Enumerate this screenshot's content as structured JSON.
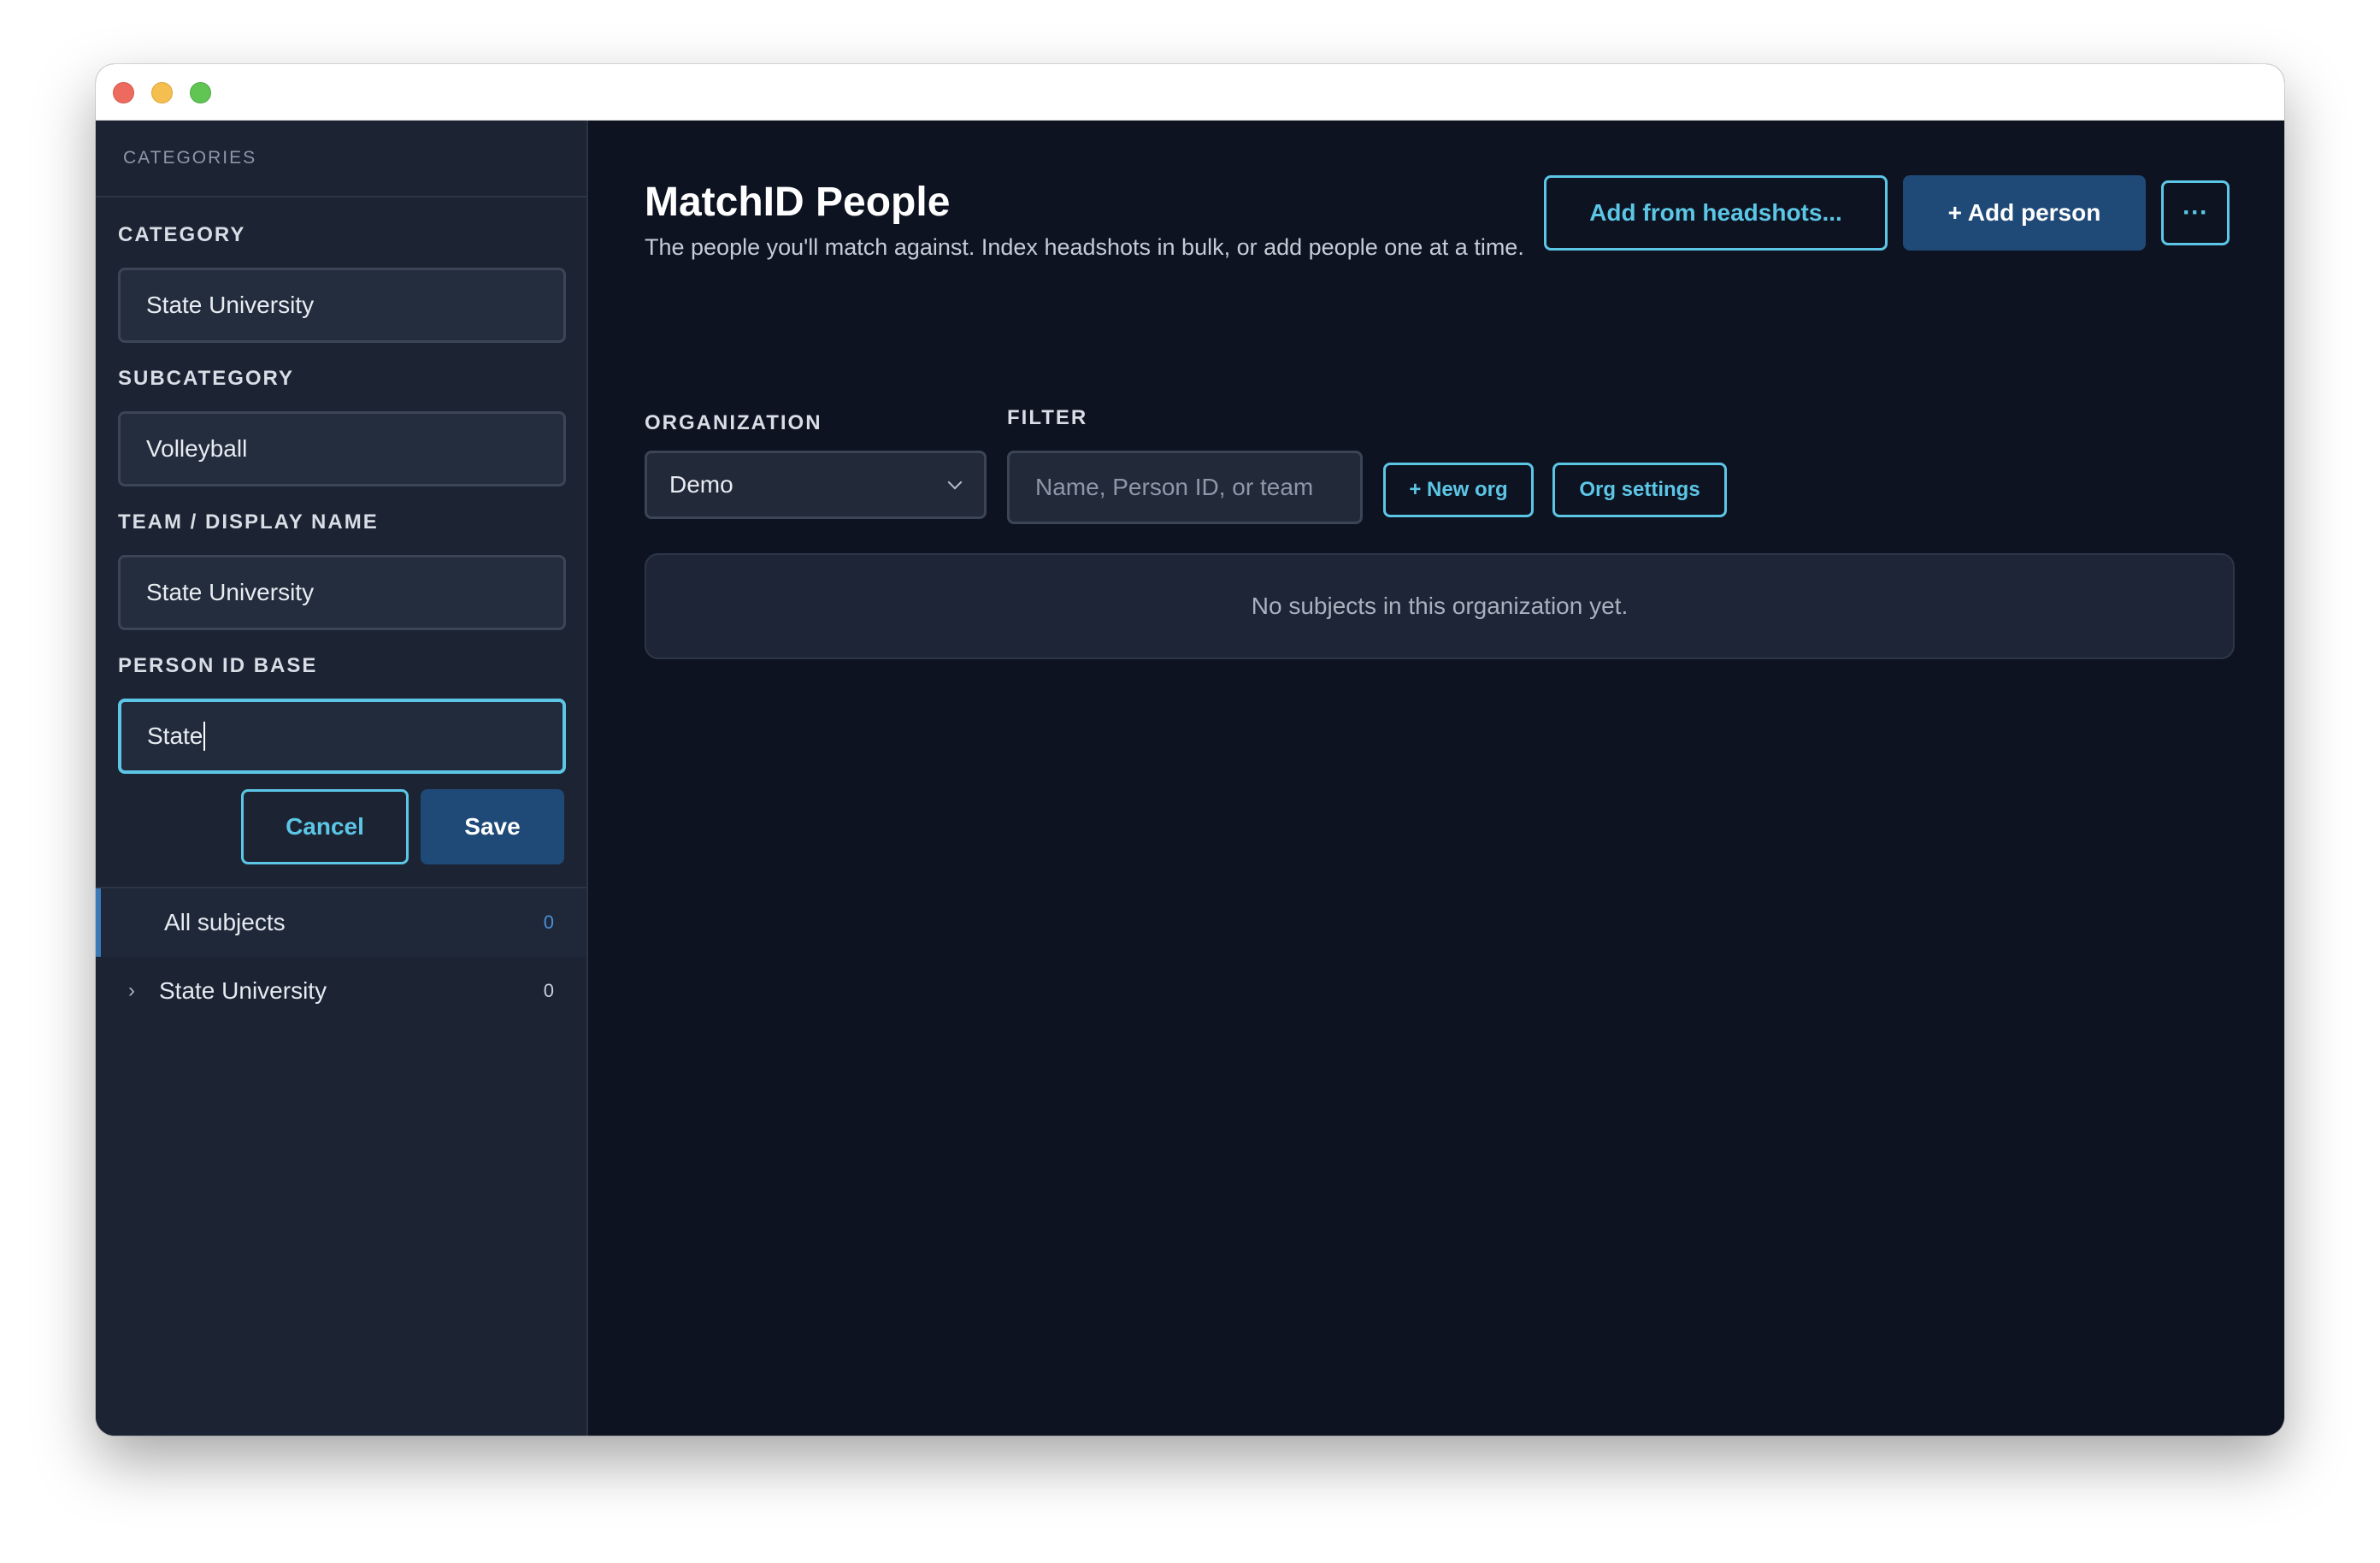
{
  "sidebar": {
    "header": "CATEGORIES",
    "form": {
      "category_label": "CATEGORY",
      "category_value": "State University",
      "subcategory_label": "SUBCATEGORY",
      "subcategory_value": "Volleyball",
      "team_label": "TEAM / DISPLAY NAME",
      "team_value": "State University",
      "person_id_label": "PERSON ID BASE",
      "person_id_value": "State",
      "cancel_label": "Cancel",
      "save_label": "Save"
    },
    "tree": [
      {
        "label": "All subjects",
        "count": "0",
        "active": true
      },
      {
        "label": "State University",
        "count": "0",
        "active": false,
        "icon": "chevron-right-icon"
      }
    ]
  },
  "main": {
    "title": "MatchID People",
    "subtitle": "The people you'll match against. Index headshots in bulk, or add people one at a time.",
    "actions": {
      "headshots_label": "Add from headshots...",
      "add_person_label": "+ Add person",
      "more_label": "···"
    },
    "organization": {
      "label": "ORGANIZATION",
      "selected": "Demo"
    },
    "filter": {
      "label": "FILTER",
      "placeholder": "Name, Person ID, or team",
      "value": ""
    },
    "new_org_label": "+ New org",
    "org_settings_label": "Org settings",
    "empty_message": "No subjects in this organization yet."
  },
  "colors": {
    "accent": "#5cc6e6",
    "primary_button": "#1f4a78",
    "background": "#0d1320",
    "sidebar": "#1c2433"
  }
}
